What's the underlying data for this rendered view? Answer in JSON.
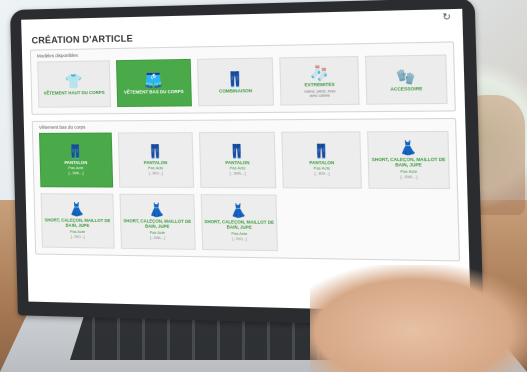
{
  "app": {
    "title": "CRÉATION D'ARTICLE",
    "refresh_icon": "refresh-icon"
  },
  "models_panel": {
    "label": "Modèles disponibles",
    "items": [
      {
        "icon": "tshirt-icon",
        "label": "VÊTEMENT HAUT DU CORPS",
        "sub": "",
        "active": false
      },
      {
        "icon": "shorts-icon",
        "label": "VÊTEMENT BAS DU CORPS",
        "sub": "",
        "active": true
      },
      {
        "icon": "overall-icon",
        "label": "COMBINAISON",
        "sub": "",
        "active": false
      },
      {
        "icon": "socks-icon",
        "label": "EXTRÉMITÉS",
        "sub": "mains, pieds, bras\navec cabine",
        "active": false
      },
      {
        "icon": "accessory-icon",
        "label": "ACCESSOIRE",
        "sub": "",
        "active": false
      }
    ]
  },
  "products_panel": {
    "label": "Vêtement bas du corps",
    "items": [
      {
        "icon": "pants-icon",
        "title": "PANTALON",
        "sub": "Pas Acte",
        "code": "[...SWL...]",
        "active": true
      },
      {
        "icon": "pants-icon",
        "title": "PANTALON",
        "sub": "Pas Acte",
        "code": "[...RIO...]",
        "active": false
      },
      {
        "icon": "pants-icon",
        "title": "PANTALON",
        "sub": "Pas Acte",
        "code": "[...SWL...]",
        "active": false
      },
      {
        "icon": "pants-icon",
        "title": "PANTALON",
        "sub": "Pas Acte",
        "code": "[...RIO...]",
        "active": false
      },
      {
        "icon": "skirt-icon",
        "title": "SHORT, CALEÇON, MAILLOT DE BAIN, JUPE",
        "sub": "Pas Acte",
        "code": "[...SWL...]",
        "active": false
      },
      {
        "icon": "skirt-icon",
        "title": "SHORT, CALEÇON, MAILLOT DE BAIN, JUPE",
        "sub": "Pas Acte",
        "code": "[...RIO...]",
        "active": false
      },
      {
        "icon": "skirt-icon",
        "title": "SHORT, CALEÇON, MAILLOT DE BAIN, JUPE",
        "sub": "Pas Acte",
        "code": "[...SWL...]",
        "active": false
      },
      {
        "icon": "skirt-icon",
        "title": "SHORT, CALEÇON, MAILLOT DE BAIN, JUPE",
        "sub": "Pas Acte",
        "code": "[...RIO...]",
        "active": false
      }
    ]
  },
  "colors": {
    "accent": "#4aaa4a",
    "accent_text": "#3a9a3a",
    "tile_bg": "#ececec"
  }
}
